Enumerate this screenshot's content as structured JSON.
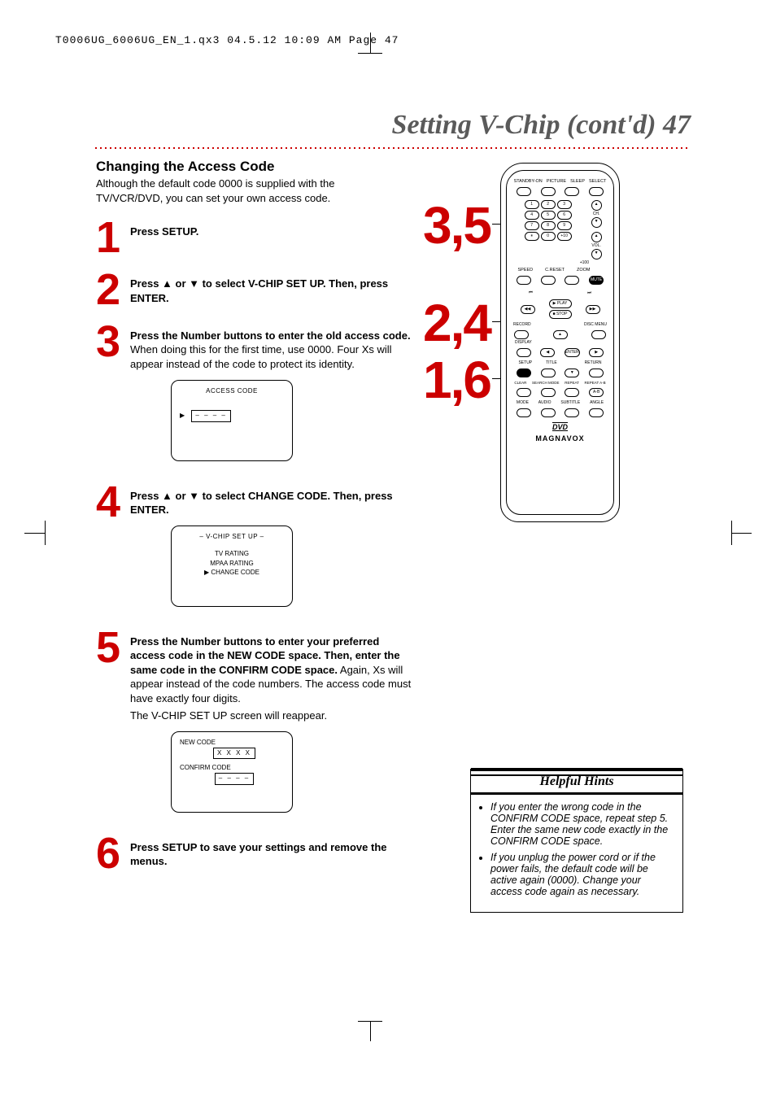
{
  "print_header": "T0006UG_6006UG_EN_1.qx3  04.5.12  10:09 AM  Page 47",
  "page_title": "Setting V-Chip (cont'd)  47",
  "section_heading": "Changing the Access Code",
  "intro": "Although the default code 0000 is supplied with the TV/VCR/DVD, you can set your own access code.",
  "steps": {
    "s1": {
      "num": "1",
      "bold": "Press SETUP."
    },
    "s2": {
      "num": "2",
      "bold": "Press ▲ or ▼ to select V-CHIP SET UP. Then, press ENTER."
    },
    "s3": {
      "num": "3",
      "bold": "Press the Number buttons to enter the old access code.",
      "rest": " When doing this for the first time, use 0000. Four Xs will appear instead of the code to protect its identity."
    },
    "s4": {
      "num": "4",
      "bold": "Press ▲ or ▼ to select CHANGE CODE. Then, press ENTER."
    },
    "s5": {
      "num": "5",
      "bold": "Press the Number buttons to enter your preferred access code in the NEW CODE space. Then, enter the same code in the CONFIRM CODE space.",
      "rest": " Again, Xs will appear instead of the code numbers. The access code must have exactly four digits.",
      "extra": "The V-CHIP SET UP screen will reappear."
    },
    "s6": {
      "num": "6",
      "bold": "Press SETUP to save your settings and remove the menus."
    }
  },
  "osd1": {
    "title": "ACCESS CODE",
    "value": "– – – –"
  },
  "osd2": {
    "title": "– V-CHIP SET UP –",
    "line1": "TV RATING",
    "line2": "MPAA RATING",
    "line3": "CHANGE CODE"
  },
  "osd3": {
    "label1": "NEW CODE",
    "value1": "X X X X",
    "label2": "CONFIRM CODE",
    "value2": "– – – –"
  },
  "callouts": {
    "c35": "3,5",
    "c24": "2,4",
    "c16": "1,6"
  },
  "remote": {
    "row1": [
      "STANDBY-ON",
      "PICTURE",
      "SLEEP",
      "SELECT"
    ],
    "numbers": [
      "1",
      "2",
      "3",
      "4",
      "5",
      "6",
      "7",
      "8",
      "9",
      "0"
    ],
    "ch_label": "CH.",
    "vol_label": "VOL.",
    "plus100": "+100",
    "plus10": "+10",
    "row_speed": [
      "SPEED",
      "C.RESET",
      "ZOOM"
    ],
    "mute": "MUTE",
    "play": "PLAY",
    "stop": "STOP",
    "record": "RECORD",
    "display": "DISPLAY",
    "discmenu": "DISC MENU",
    "nav": {
      "enter": "ENTER"
    },
    "row_setup": [
      "SETUP",
      "TITLE",
      "",
      "RETURN"
    ],
    "row_clear": [
      "CLEAR",
      "SEARCH MODE",
      "REPEAT",
      "REPEAT A-B"
    ],
    "row_mode": [
      "MODE",
      "AUDIO",
      "SUBTITLE",
      "ANGLE"
    ],
    "logo_dvd": "DVD",
    "brand": "MAGNAVOX"
  },
  "hints": {
    "title": "Helpful Hints",
    "items": [
      "If you enter the wrong code in the CONFIRM CODE space, repeat step 5. Enter the same new code exactly in the CONFIRM CODE space.",
      "If you unplug the power cord or if the power fails, the default code will be active again (0000). Change your access code again as necessary."
    ]
  }
}
